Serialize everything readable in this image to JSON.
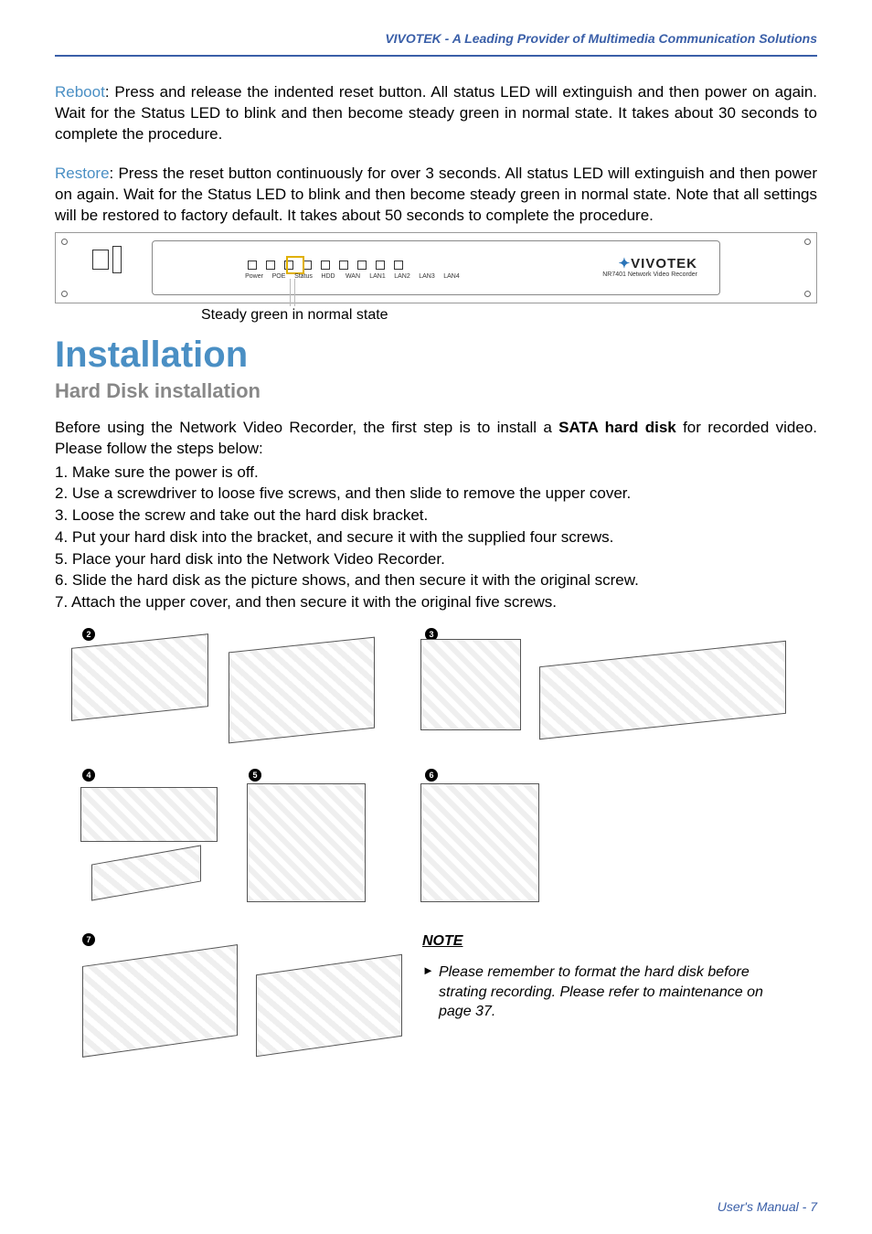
{
  "header": {
    "text": "VIVOTEK - A Leading Provider of Multimedia Communication Solutions"
  },
  "reboot": {
    "label": "Reboot",
    "text": ": Press and release the indented reset button. All status LED will extinguish and then power on again. Wait for the Status LED to blink and then become steady green in normal state. It takes about 30 seconds to complete the procedure."
  },
  "restore": {
    "label": "Restore",
    "text": ": Press the reset button continuously for over 3 seconds. All status LED will extinguish and then power on again. Wait for the Status LED to blink and then become steady green in normal state. Note that all settings will be restored to factory default. It takes about 50 seconds to complete the procedure."
  },
  "diagram": {
    "led_labels": [
      "Power",
      "POE",
      "Status",
      "HDD",
      "WAN",
      "LAN1",
      "LAN2",
      "LAN3",
      "LAN4"
    ],
    "brand": "VIVOTEK",
    "brand_sub": "NR7401 Network Video Recorder",
    "caption": "Steady green in normal state"
  },
  "installation": {
    "title": "Installation",
    "subtitle": "Hard Disk installation",
    "intro_pre": "Before using the Network Video Recorder, the first step is to install a ",
    "intro_bold": "SATA hard disk",
    "intro_post": " for recorded video. Please follow the steps below:",
    "steps": [
      "1. Make sure the power is off.",
      "2. Use a screwdriver to loose five screws, and then slide to remove the upper cover.",
      "3. Loose the screw and take out the hard disk bracket.",
      "4. Put your hard disk into the bracket, and secure it with the supplied four screws.",
      "5. Place your hard disk into the Network Video Recorder.",
      "6. Slide the hard disk as the picture shows, and then secure it with the original screw.",
      "7. Attach the upper cover, and then secure it with the original five screws."
    ]
  },
  "badges": [
    "2",
    "3",
    "4",
    "5",
    "6",
    "7"
  ],
  "note": {
    "heading": "NOTE",
    "body": "Please remember to format the hard disk before strating recording. Please refer to maintenance on page 37."
  },
  "footer": {
    "text": "User's Manual - 7"
  }
}
